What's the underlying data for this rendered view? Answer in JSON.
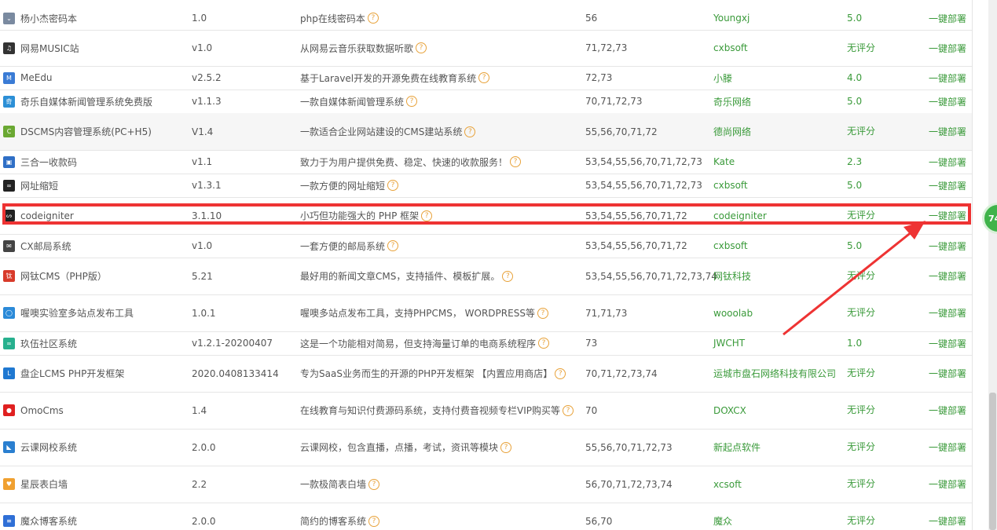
{
  "badge_text": "74",
  "deploy_label": "一键部署",
  "rows": [
    {
      "name": "杨小杰密码本",
      "version": "1.0",
      "desc": "php在线密码本",
      "php": "56",
      "author": "Youngxj",
      "score": "5.0",
      "icon": "chevron-icon",
      "color": "#7a8aa0",
      "glyph": "⌄"
    },
    {
      "name": "网易MUSIC站",
      "version": "v1.0",
      "desc": "从网易云音乐获取数据听歌",
      "php": "71,72,73",
      "author": "cxbsoft",
      "score": "无评分",
      "icon": "music-note-icon",
      "color": "#333333",
      "glyph": "♫"
    },
    {
      "name": "MeEdu",
      "version": "v2.5.2",
      "desc": "基于Laravel开发的开源免费在线教育系统",
      "php": "72,73",
      "author": "小滕",
      "score": "4.0",
      "icon": "meedu-logo-icon",
      "color": "#3a7bd5",
      "glyph": "M"
    },
    {
      "name": "奇乐自媒体新闻管理系统免费版",
      "version": "v1.1.3",
      "desc": "一款自媒体新闻管理系统",
      "php": "70,71,72,73",
      "author": "奇乐网络",
      "score": "5.0",
      "icon": "qile-logo-icon",
      "color": "#2c8fd6",
      "glyph": "奇"
    },
    {
      "name": "DSCMS内容管理系统(PC+H5)",
      "version": "V1.4",
      "desc": "一款适合企业网站建设的CMS建站系统",
      "php": "55,56,70,71,72",
      "author": "德尚网络",
      "score": "无评分",
      "icon": "cms-logo-icon",
      "color": "#6aa832",
      "glyph": "C"
    },
    {
      "name": "三合一收款码",
      "version": "v1.1",
      "desc": "致力于为用户提供免费、稳定、快速的收款服务！",
      "php": "53,54,55,56,70,71,72,73",
      "author": "Kate",
      "score": "2.3",
      "icon": "qrcode-icon",
      "color": "#2f6fc6",
      "glyph": "▣"
    },
    {
      "name": "网址缩短",
      "version": "v1.3.1",
      "desc": "一款方便的网址缩短",
      "php": "53,54,55,56,70,71,72,73",
      "author": "cxbsoft",
      "score": "5.0",
      "icon": "link-icon",
      "color": "#222222",
      "glyph": "∞"
    },
    {
      "name": "codeigniter",
      "version": "3.1.10",
      "desc": "小巧但功能强大的 PHP 框架",
      "php": "53,54,55,56,70,71,72",
      "author": "codeigniter",
      "score": "无评分",
      "icon": "flame-icon",
      "color": "#222222",
      "glyph": "ᔕ"
    },
    {
      "name": "CX邮局系统",
      "version": "v1.0",
      "desc": "一套方便的邮局系统",
      "php": "53,54,55,56,70,71,72",
      "author": "cxbsoft",
      "score": "5.0",
      "icon": "envelope-icon",
      "color": "#444444",
      "glyph": "✉"
    },
    {
      "name": "网钛CMS（PHP版）",
      "version": "5.21",
      "desc": "最好用的新闻文章CMS，支持插件、模板扩展。",
      "php": "53,54,55,56,70,71,72,73,74",
      "author": "网钛科技",
      "score": "无评分",
      "icon": "wangtai-logo-icon",
      "color": "#d83a2a",
      "glyph": "钛"
    },
    {
      "name": "喔噢实验室多站点发布工具",
      "version": "1.0.1",
      "desc": "喔噢多站点发布工具，支持PHPCMS， WORDPRESS等",
      "php": "71,71,73",
      "author": "wooolab",
      "score": "无评分",
      "icon": "drop-icon",
      "color": "#2b8ad8",
      "glyph": "◯"
    },
    {
      "name": "玖伍社区系统",
      "version": "v1.2.1-20200407",
      "desc": "这是一个功能相对简易，但支持海量订单的电商系统程序",
      "php": "73",
      "author": "JWCHT",
      "score": "1.0",
      "icon": "jiuwu-logo-icon",
      "color": "#27b08e",
      "glyph": "∞"
    },
    {
      "name": "盘企LCMS PHP开发框架",
      "version": "2020.0408133414",
      "desc": "专为SaaS业务而生的开源的PHP开发框架 【内置应用商店】",
      "php": "70,71,72,73,74",
      "author": "运城市盘石网络科技有限公司",
      "score": "无评分",
      "icon": "lcms-logo-icon",
      "color": "#1f78d1",
      "glyph": "L"
    },
    {
      "name": "OmoCms",
      "version": "1.4",
      "desc": "在线教育与知识付费源码系统，支持付费音视频专栏VIP购买等",
      "php": "70",
      "author": "DOXCX",
      "score": "无评分",
      "icon": "omocms-logo-icon",
      "color": "#e02020",
      "glyph": "●"
    },
    {
      "name": "云课网校系统",
      "version": "2.0.0",
      "desc": "云课网校，包含直播，点播，考试，资讯等模块",
      "php": "55,56,70,71,72,73",
      "author": "新起点软件",
      "score": "无评分",
      "icon": "cloud-course-icon",
      "color": "#2a7fd0",
      "glyph": "◣"
    },
    {
      "name": "星辰表白墙",
      "version": "2.2",
      "desc": "一款极简表白墙",
      "php": "56,70,71,72,73,74",
      "author": "xcsoft",
      "score": "无评分",
      "icon": "heart-icon",
      "color": "#f0a030",
      "glyph": "♥"
    },
    {
      "name": "魔众博客系统",
      "version": "2.0.0",
      "desc": "简约的博客系统",
      "php": "56,70",
      "author": "魔众",
      "score": "无评分",
      "icon": "mozhong-logo-icon",
      "color": "#2f6fd6",
      "glyph": "≡"
    }
  ]
}
